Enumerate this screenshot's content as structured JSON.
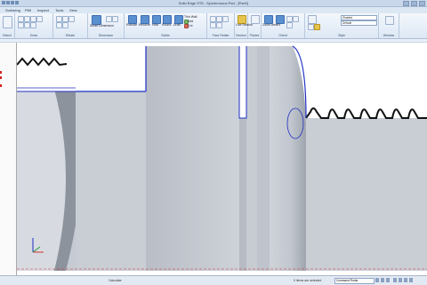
{
  "app": {
    "title": "Solid Edge ST6 - Synchronous Part - [Part1]"
  },
  "tabs": [
    "Surfacing",
    "PMI",
    "Inspect",
    "Tools",
    "View"
  ],
  "ribbon": {
    "groups": [
      {
        "id": "select",
        "label": "Select"
      },
      {
        "id": "draw",
        "label": "Draw"
      },
      {
        "id": "relate",
        "label": "Relate"
      },
      {
        "id": "dimension",
        "label": "Dimension"
      },
      {
        "id": "solids",
        "label": "Solids"
      },
      {
        "id": "face-relate",
        "label": "Face Relate"
      },
      {
        "id": "section",
        "label": "Section"
      },
      {
        "id": "planes",
        "label": "Planes"
      },
      {
        "id": "orient",
        "label": "Orient"
      },
      {
        "id": "style",
        "label": "Style"
      },
      {
        "id": "window",
        "label": "Window"
      }
    ],
    "tools": {
      "smart_dimension": "Smart Dimension",
      "extrude": "Extrude",
      "revolve": "Revolve",
      "hole": "Hole",
      "round": "Round",
      "draft": "Draft",
      "thin_wall": "Thin Wall",
      "add": "Add",
      "cut": "Cut",
      "live_section": "Live Section",
      "zoom_area": "Zoom Area",
      "fit": "Fit"
    },
    "style_fields": {
      "style_value": "Shaded",
      "material_value": "Default"
    }
  },
  "status": {
    "left": "Calculate",
    "selection": "0 items are selected",
    "command_placeholder": "Command Finder"
  },
  "colors": {
    "edge_blue": "#1d2fc4",
    "model_grey": "#c3c8d0",
    "background": "#ffffff",
    "accent_red": "#d43030"
  }
}
